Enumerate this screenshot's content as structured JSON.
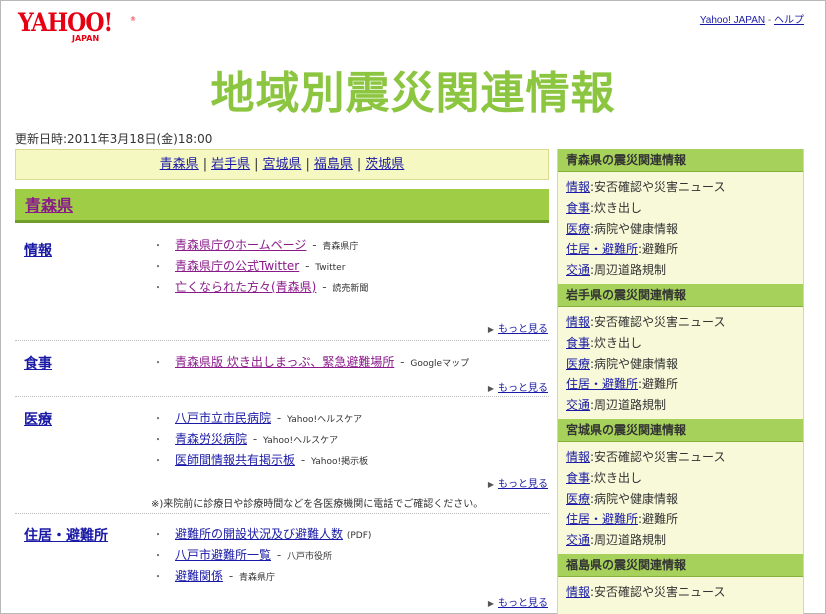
{
  "header": {
    "logo_text": "YAHOO!",
    "logo_sub": "JAPAN",
    "logo_reg": "®",
    "links": {
      "yahoo_japan": "Yahoo! JAPAN",
      "separator": " - ",
      "help": "ヘルプ"
    }
  },
  "title": "地域別震災関連情報",
  "updated": "更新日時:2011年3月18日(金)18:00",
  "pref_nav": [
    "青森県",
    "岩手県",
    "宮城県",
    "福島県",
    "茨城県"
  ],
  "pref_nav_sep": "|",
  "current_pref": "青森県",
  "sections": [
    {
      "title": "情報",
      "items": [
        {
          "label": "青森県庁のホームページ",
          "source": "青森県庁"
        },
        {
          "label": "青森県庁の公式Twitter",
          "source": "Twitter"
        },
        {
          "label": "亡くなられた方々(青森県)",
          "source": "読売新聞"
        }
      ],
      "more": "もっと見る"
    },
    {
      "title": "食事",
      "items": [
        {
          "label": "青森県版 炊き出しまっぷ、緊急避難場所",
          "source": "Googleマップ"
        }
      ],
      "more": "もっと見る"
    },
    {
      "title": "医療",
      "items": [
        {
          "label": "八戸市立市民病院",
          "source": "Yahoo!ヘルスケア"
        },
        {
          "label": "青森労災病院",
          "source": "Yahoo!ヘルスケア"
        },
        {
          "label": "医師間情報共有掲示板",
          "source": "Yahoo!掲示板"
        }
      ],
      "more": "もっと見る",
      "note": "※)来院前に診療日や診療時間などを各医療機関に電話でご確認ください。"
    },
    {
      "title": "住居・避難所",
      "items": [
        {
          "label": "避難所の開設状況及び避難人数",
          "source": "(PDF)"
        },
        {
          "label": "八戸市避難所一覧",
          "source": "八戸市役所"
        },
        {
          "label": "避難関係",
          "source": "青森県庁"
        }
      ],
      "more": "もっと見る"
    }
  ],
  "item_dot": "・",
  "item_dash": "-",
  "sidebar": [
    {
      "heading": "青森県の震災関連情報",
      "rows": [
        {
          "link": "情報",
          "text": ":安否確認や災害ニュース"
        },
        {
          "link": "食事",
          "text": ":炊き出し"
        },
        {
          "link": "医療",
          "text": ":病院や健康情報"
        },
        {
          "link": "住居・避難所",
          "text": ":避難所"
        },
        {
          "link": "交通",
          "text": ":周辺道路規制"
        }
      ]
    },
    {
      "heading": "岩手県の震災関連情報",
      "rows": [
        {
          "link": "情報",
          "text": ":安否確認や災害ニュース"
        },
        {
          "link": "食事",
          "text": ":炊き出し"
        },
        {
          "link": "医療",
          "text": ":病院や健康情報"
        },
        {
          "link": "住居・避難所",
          "text": ":避難所"
        },
        {
          "link": "交通",
          "text": ":周辺道路規制"
        }
      ]
    },
    {
      "heading": "宮城県の震災関連情報",
      "rows": [
        {
          "link": "情報",
          "text": ":安否確認や災害ニュース"
        },
        {
          "link": "食事",
          "text": ":炊き出し"
        },
        {
          "link": "医療",
          "text": ":病院や健康情報"
        },
        {
          "link": "住居・避難所",
          "text": ":避難所"
        },
        {
          "link": "交通",
          "text": ":周辺道路規制"
        }
      ]
    },
    {
      "heading": "福島県の震災関連情報",
      "rows": [
        {
          "link": "情報",
          "text": ":安否確認や災害ニュース"
        }
      ]
    }
  ],
  "colors": {
    "title_green": "#8cc641",
    "header_green": "#9fcd46",
    "link_blue": "#1a1aa6",
    "visited_purple": "#8a1a8a",
    "logo_red": "#e60012"
  }
}
